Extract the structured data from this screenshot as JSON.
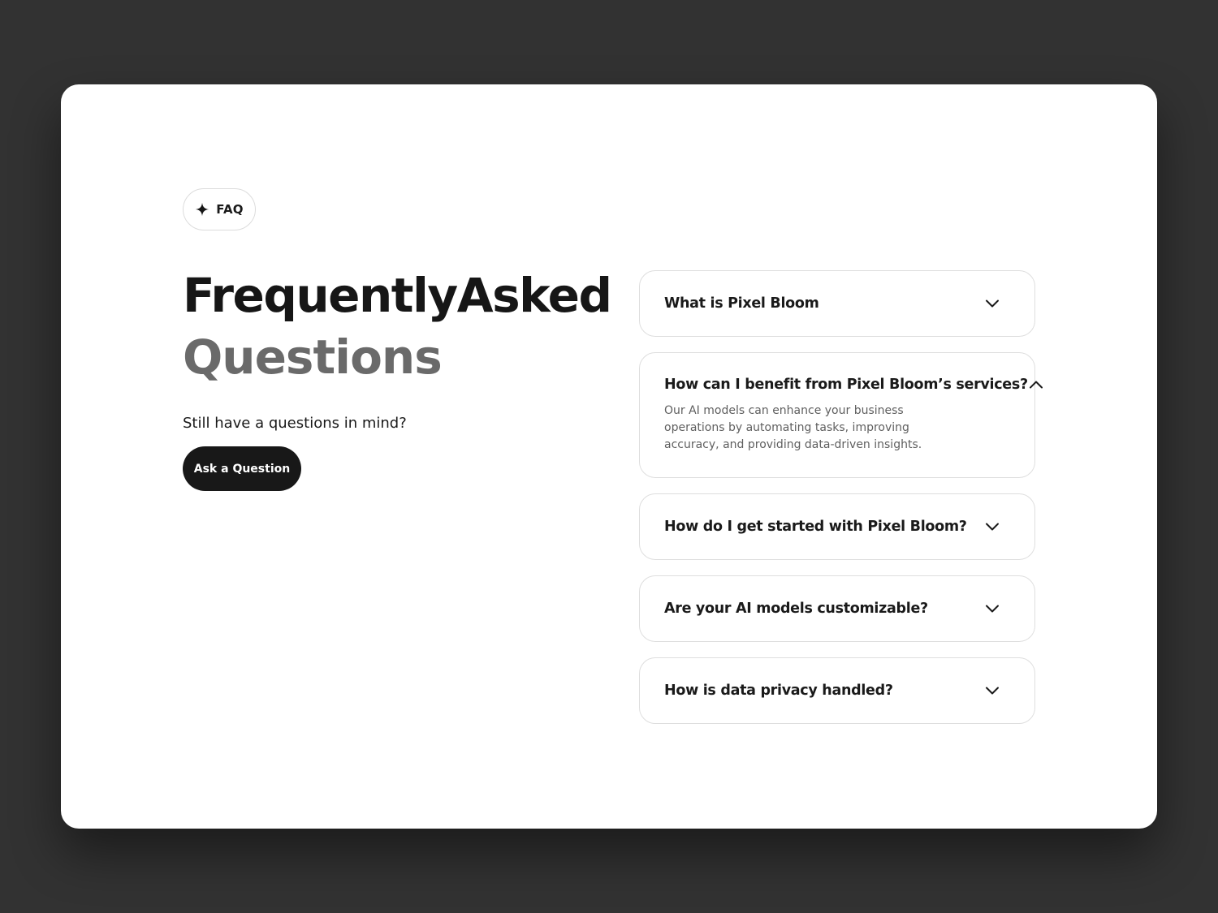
{
  "badge": {
    "icon": "sparkle-icon",
    "label": "FAQ"
  },
  "headline": {
    "line1": "FrequentlyAsked",
    "line2": "Questions"
  },
  "subtext": "Still have a questions in mind?",
  "cta": {
    "label": "Ask a Question"
  },
  "faq": [
    {
      "question": "What is Pixel Bloom",
      "expanded": false,
      "icon": "chevron-down-icon"
    },
    {
      "question": "How can I benefit from Pixel Bloom’s services?",
      "expanded": true,
      "icon": "chevron-up-icon",
      "answer": "Our AI models can enhance your business operations by automating tasks, improving accuracy, and providing data-driven insights."
    },
    {
      "question": "How do I get started with Pixel Bloom?",
      "expanded": false,
      "icon": "chevron-down-icon"
    },
    {
      "question": "Are your AI models customizable?",
      "expanded": false,
      "icon": "chevron-down-icon"
    },
    {
      "question": "How is data privacy handled?",
      "expanded": false,
      "icon": "chevron-down-icon"
    }
  ],
  "colors": {
    "page_background": "#323232",
    "card_background": "#ffffff",
    "text_primary": "#161616",
    "text_secondary": "#6a6a6a",
    "button_background": "#181818",
    "border": "#dedede"
  }
}
